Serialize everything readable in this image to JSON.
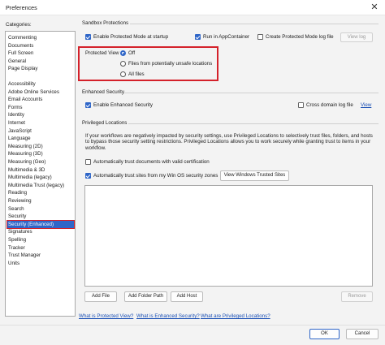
{
  "window": {
    "title": "Preferences",
    "close_glyph": "✕"
  },
  "categories": {
    "label": "Categories:",
    "group1": [
      "Commenting",
      "Documents",
      "Full Screen",
      "General",
      "Page Display"
    ],
    "group2": [
      "Accessibility",
      "Adobe Online Services",
      "Email Accounts",
      "Forms",
      "Identity",
      "Internet",
      "JavaScript",
      "Language",
      "Measuring (2D)",
      "Measuring (3D)",
      "Measuring (Geo)",
      "Multimedia & 3D",
      "Multimedia (legacy)",
      "Multimedia Trust (legacy)",
      "Reading",
      "Reviewing",
      "Search",
      "Security",
      "Security (Enhanced)",
      "Signatures",
      "Spelling",
      "Tracker",
      "Trust Manager",
      "Units"
    ],
    "selected": "Security (Enhanced)"
  },
  "sandbox": {
    "title": "Sandbox Protections",
    "protected_mode": {
      "label": "Enable Protected Mode at startup",
      "checked": true
    },
    "app_container": {
      "label": "Run in AppContainer",
      "checked": true
    },
    "log_file": {
      "label": "Create Protected Mode log file",
      "checked": false
    },
    "view_log": "View log"
  },
  "protected_view": {
    "label": "Protected View",
    "options": [
      "Off",
      "Files from potentially unsafe locations",
      "All files"
    ],
    "selected": "Off"
  },
  "enhanced": {
    "title": "Enhanced Security",
    "enable": {
      "label": "Enable Enhanced Security",
      "checked": true
    },
    "cross_domain": {
      "label": "Cross domain log file",
      "checked": false
    },
    "view": "View"
  },
  "privileged": {
    "title": "Privileged Locations",
    "description": "If your workflows are negatively impacted by security settings, use Privileged Locations to selectively trust files, folders, and hosts to bypass those security setting restrictions. Privileged Locations allows you to work securely while granting trust to items in your workflow.",
    "auto_cert": {
      "label": "Automatically trust documents with valid certification",
      "checked": false
    },
    "auto_win": {
      "label": "Automatically trust sites from my Win OS security zones",
      "checked": true
    },
    "view_sites": "View Windows Trusted Sites",
    "add_file": "Add File",
    "add_folder": "Add Folder Path",
    "add_host": "Add Host",
    "remove": "Remove"
  },
  "links": [
    "What is Protected View?",
    "What is Enhanced Security?",
    "What are Privileged Locations?"
  ],
  "footer": {
    "ok": "OK",
    "cancel": "Cancel"
  },
  "colors": {
    "accent": "#2f66c8",
    "highlight_box": "#d4212a",
    "link": "#1a4fb5"
  }
}
